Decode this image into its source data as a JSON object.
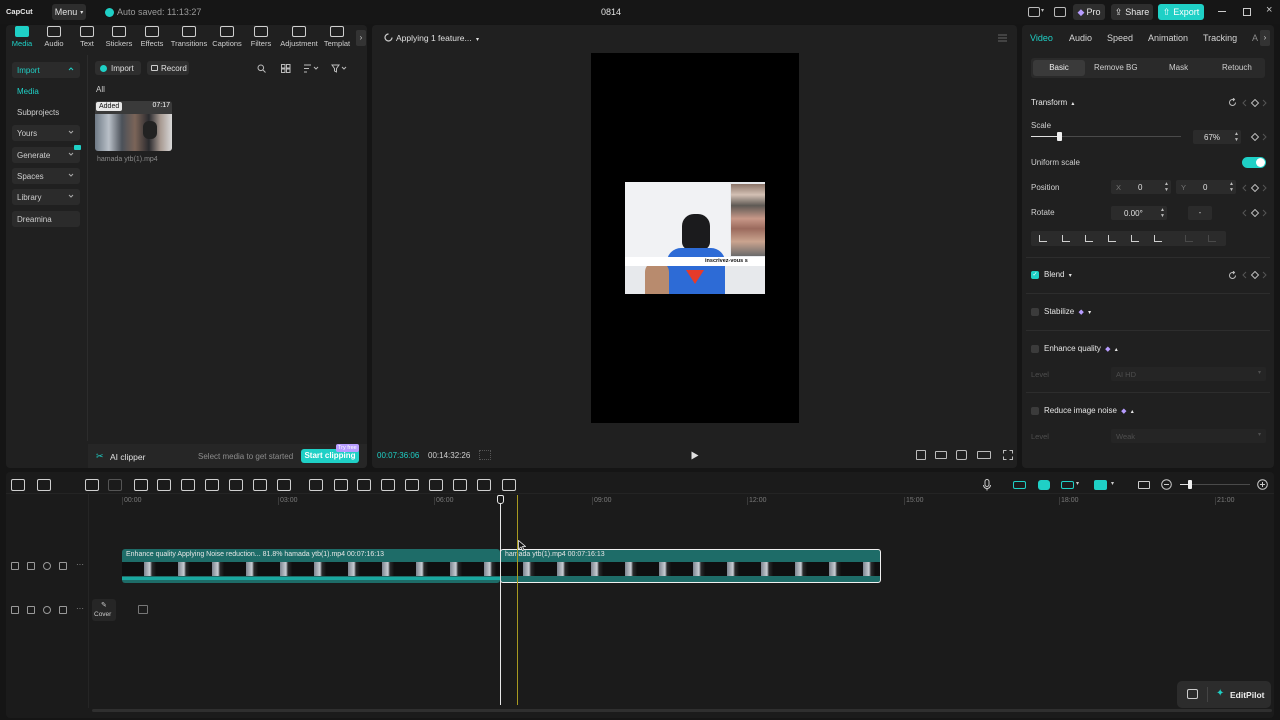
{
  "titlebar": {
    "app_name": "CapCut",
    "menu_label": "Menu",
    "autosave": "Auto saved: 11:13:27",
    "project_name": "0814",
    "pro_label": "Pro",
    "share_label": "Share",
    "export_label": "Export"
  },
  "toolbar": [
    {
      "label": "Media",
      "icon": "media-icon",
      "active": true
    },
    {
      "label": "Audio",
      "icon": "audio-icon"
    },
    {
      "label": "Text",
      "icon": "text-icon"
    },
    {
      "label": "Stickers",
      "icon": "stickers-icon"
    },
    {
      "label": "Effects",
      "icon": "effects-icon"
    },
    {
      "label": "Transitions",
      "icon": "transitions-icon"
    },
    {
      "label": "Captions",
      "icon": "captions-icon"
    },
    {
      "label": "Filters",
      "icon": "filters-icon"
    },
    {
      "label": "Adjustment",
      "icon": "adjustment-icon"
    },
    {
      "label": "Templat",
      "icon": "templates-icon"
    }
  ],
  "sidebar": {
    "items": [
      {
        "label": "Import"
      },
      {
        "label": "Media"
      },
      {
        "label": "Subprojects"
      },
      {
        "label": "Yours"
      },
      {
        "label": "Generate"
      },
      {
        "label": "Spaces"
      },
      {
        "label": "Library"
      },
      {
        "label": "Dreamina"
      }
    ]
  },
  "media": {
    "import_label": "Import",
    "record_label": "Record",
    "filter_label": "All",
    "clip": {
      "badge": "Added",
      "duration": "07:17",
      "name": "hamada ytb(1).mp4"
    },
    "ai_clipper": "AI clipper",
    "ai_hint": "Select media to get started",
    "start_clipping": "Start clipping",
    "try_free": "Try free"
  },
  "player": {
    "status": "Applying 1 feature...",
    "current_time": "00:07:36:06",
    "total_time": "00:14:32:26",
    "subscribe_text": "inscrivez-vous s"
  },
  "inspector": {
    "tabs": [
      "Video",
      "Audio",
      "Speed",
      "Animation",
      "Tracking",
      "A"
    ],
    "subtabs": [
      "Basic",
      "Remove BG",
      "Mask",
      "Retouch"
    ],
    "transform_label": "Transform",
    "scale_label": "Scale",
    "scale_value": "67%",
    "scale_fraction": 0.67,
    "uniform_scale_label": "Uniform scale",
    "uniform_scale_on": true,
    "position_label": "Position",
    "x_label": "X",
    "x_value": "0",
    "y_label": "Y",
    "y_value": "0",
    "rotate_label": "Rotate",
    "rotate_value": "0.00°",
    "rotate_dash": "-",
    "blend_label": "Blend",
    "stabilize_label": "Stabilize",
    "enhance_label": "Enhance quality",
    "level_label": "Level",
    "enhance_level": "AI HD",
    "noise_label": "Reduce image noise",
    "noise_level": "Weak"
  },
  "timeline": {
    "ruler": [
      "00:00",
      "03:00",
      "06:00",
      "09:00",
      "12:00",
      "15:00",
      "18:00",
      "21:00"
    ],
    "clip1_label": "Enhance quality  Applying Noise reduction... 81.8%  hamada ytb(1).mp4  00:07:16:13",
    "clip2_label": "hamada ytb(1).mp4  00:07:16:13",
    "cover_label": "Cover",
    "editpilot_label": "EditPilot"
  },
  "colors": {
    "accent": "#1fd0c6",
    "clip_teal": "#1e6c68",
    "panel": "#202020"
  }
}
